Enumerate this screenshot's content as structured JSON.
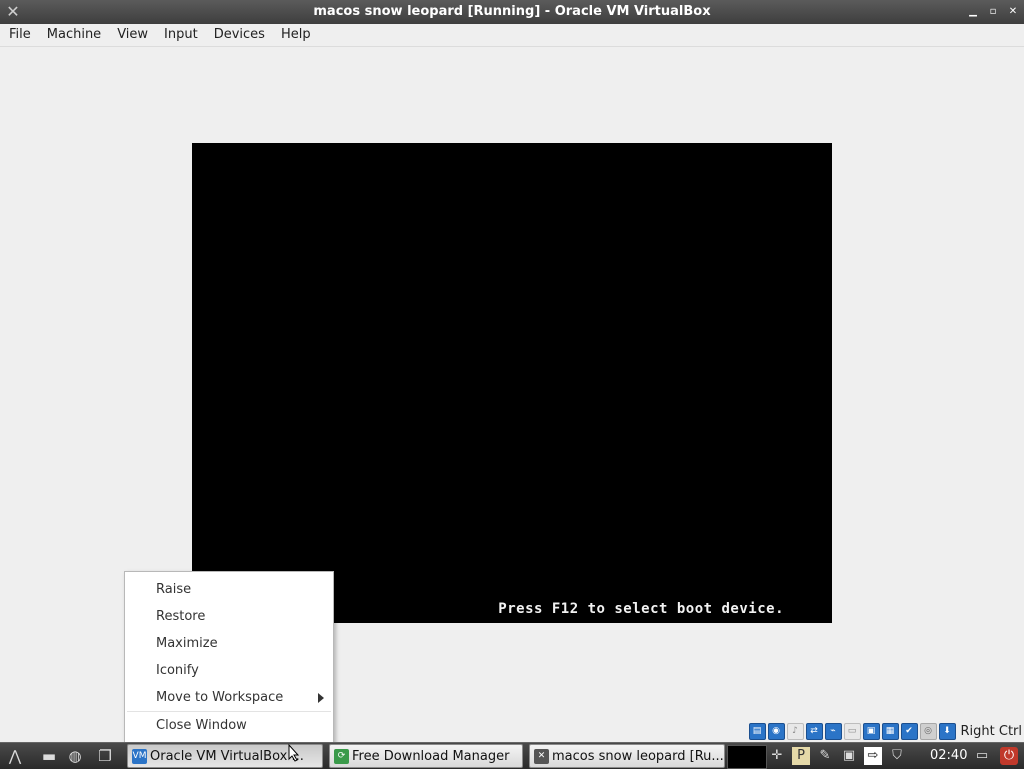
{
  "window": {
    "title": "macos snow leopard [Running] - Oracle VM VirtualBox",
    "controls": [
      "minimize",
      "restore",
      "close"
    ]
  },
  "menubar": {
    "items": [
      "File",
      "Machine",
      "View",
      "Input",
      "Devices",
      "Help"
    ]
  },
  "vm": {
    "boot_message": "Press F12 to select boot device."
  },
  "statusbar": {
    "icons": [
      "hard-disk-icon",
      "optical-drive-icon",
      "audio-icon",
      "network-icon",
      "usb-icon",
      "shared-folder-icon",
      "display-icon",
      "video-capture-icon",
      "cpu-icon",
      "mouse-integration-icon",
      "host-key-icon"
    ],
    "host_key": "Right Ctrl"
  },
  "context_menu": {
    "items": [
      {
        "label": "Raise"
      },
      {
        "label": "Restore"
      },
      {
        "label": "Maximize"
      },
      {
        "label": "Iconify"
      },
      {
        "label": "Move to Workspace",
        "submenu": true
      },
      {
        "label": "Close Window"
      }
    ]
  },
  "taskbar": {
    "tasks": [
      {
        "label": "Oracle VM VirtualBox ...",
        "icon": "virtualbox-icon",
        "active": true
      },
      {
        "label": "Free Download Manager",
        "icon": "fdm-icon",
        "active": false
      },
      {
        "label": "macos snow leopard [Ru...",
        "icon": "vm-window-icon",
        "active": false
      }
    ],
    "clock": "02:40"
  },
  "colors": {
    "accent": "#2b74c7",
    "vm_background": "#000000",
    "window_background": "#efefef"
  }
}
